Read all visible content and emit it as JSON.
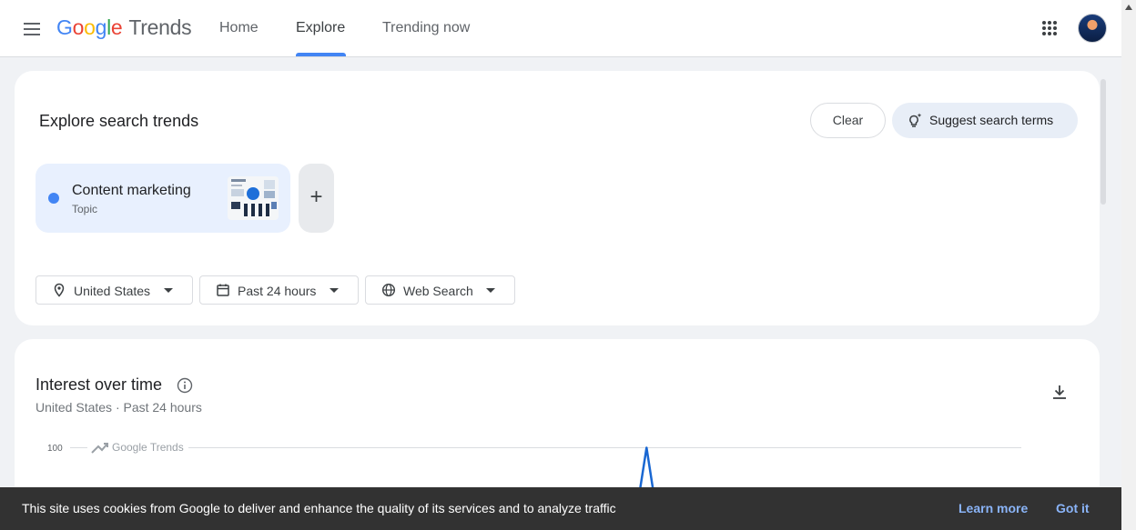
{
  "header": {
    "logo_letters": [
      "G",
      "o",
      "o",
      "g",
      "l",
      "e"
    ],
    "logo_product": "Trends",
    "nav": [
      {
        "label": "Home"
      },
      {
        "label": "Explore",
        "active": true
      },
      {
        "label": "Trending now"
      }
    ],
    "icons": {
      "menu": "menu-icon",
      "apps": "apps-grid-icon",
      "avatar": "account-avatar"
    }
  },
  "explore": {
    "title": "Explore search trends",
    "clear_label": "Clear",
    "suggest_label": "Suggest search terms",
    "term": {
      "name": "Content marketing",
      "type": "Topic",
      "color": "#4285f4"
    },
    "add_label": "+",
    "filters": [
      {
        "label": "United States",
        "icon": "location-pin-icon"
      },
      {
        "label": "Past 24 hours",
        "icon": "calendar-icon"
      },
      {
        "label": "Web Search",
        "icon": "globe-icon"
      }
    ]
  },
  "interest": {
    "title": "Interest over time",
    "subtitle": "United States · Past 24 hours"
  },
  "chart_data": {
    "type": "line",
    "title": "",
    "watermark": "Google Trends",
    "y_ticks": [
      100
    ],
    "ylim": [
      0,
      100
    ],
    "series": [
      {
        "color": "#1967d2",
        "points": [
          [
            0.0,
            0
          ],
          [
            0.54,
            0
          ],
          [
            0.55,
            100
          ],
          [
            0.56,
            0
          ],
          [
            1.0,
            0
          ]
        ]
      }
    ],
    "visible_y_range": [
      88,
      100
    ]
  },
  "cookie": {
    "text": "This site uses cookies from Google to deliver and enhance the quality of its services and to analyze traffic",
    "learn_more": "Learn more",
    "got_it": "Got it"
  },
  "colors": {
    "accent": "#4285f4",
    "chip_bg": "#e8f0fe",
    "banner": "#323232",
    "link": "#8ab4f8"
  }
}
